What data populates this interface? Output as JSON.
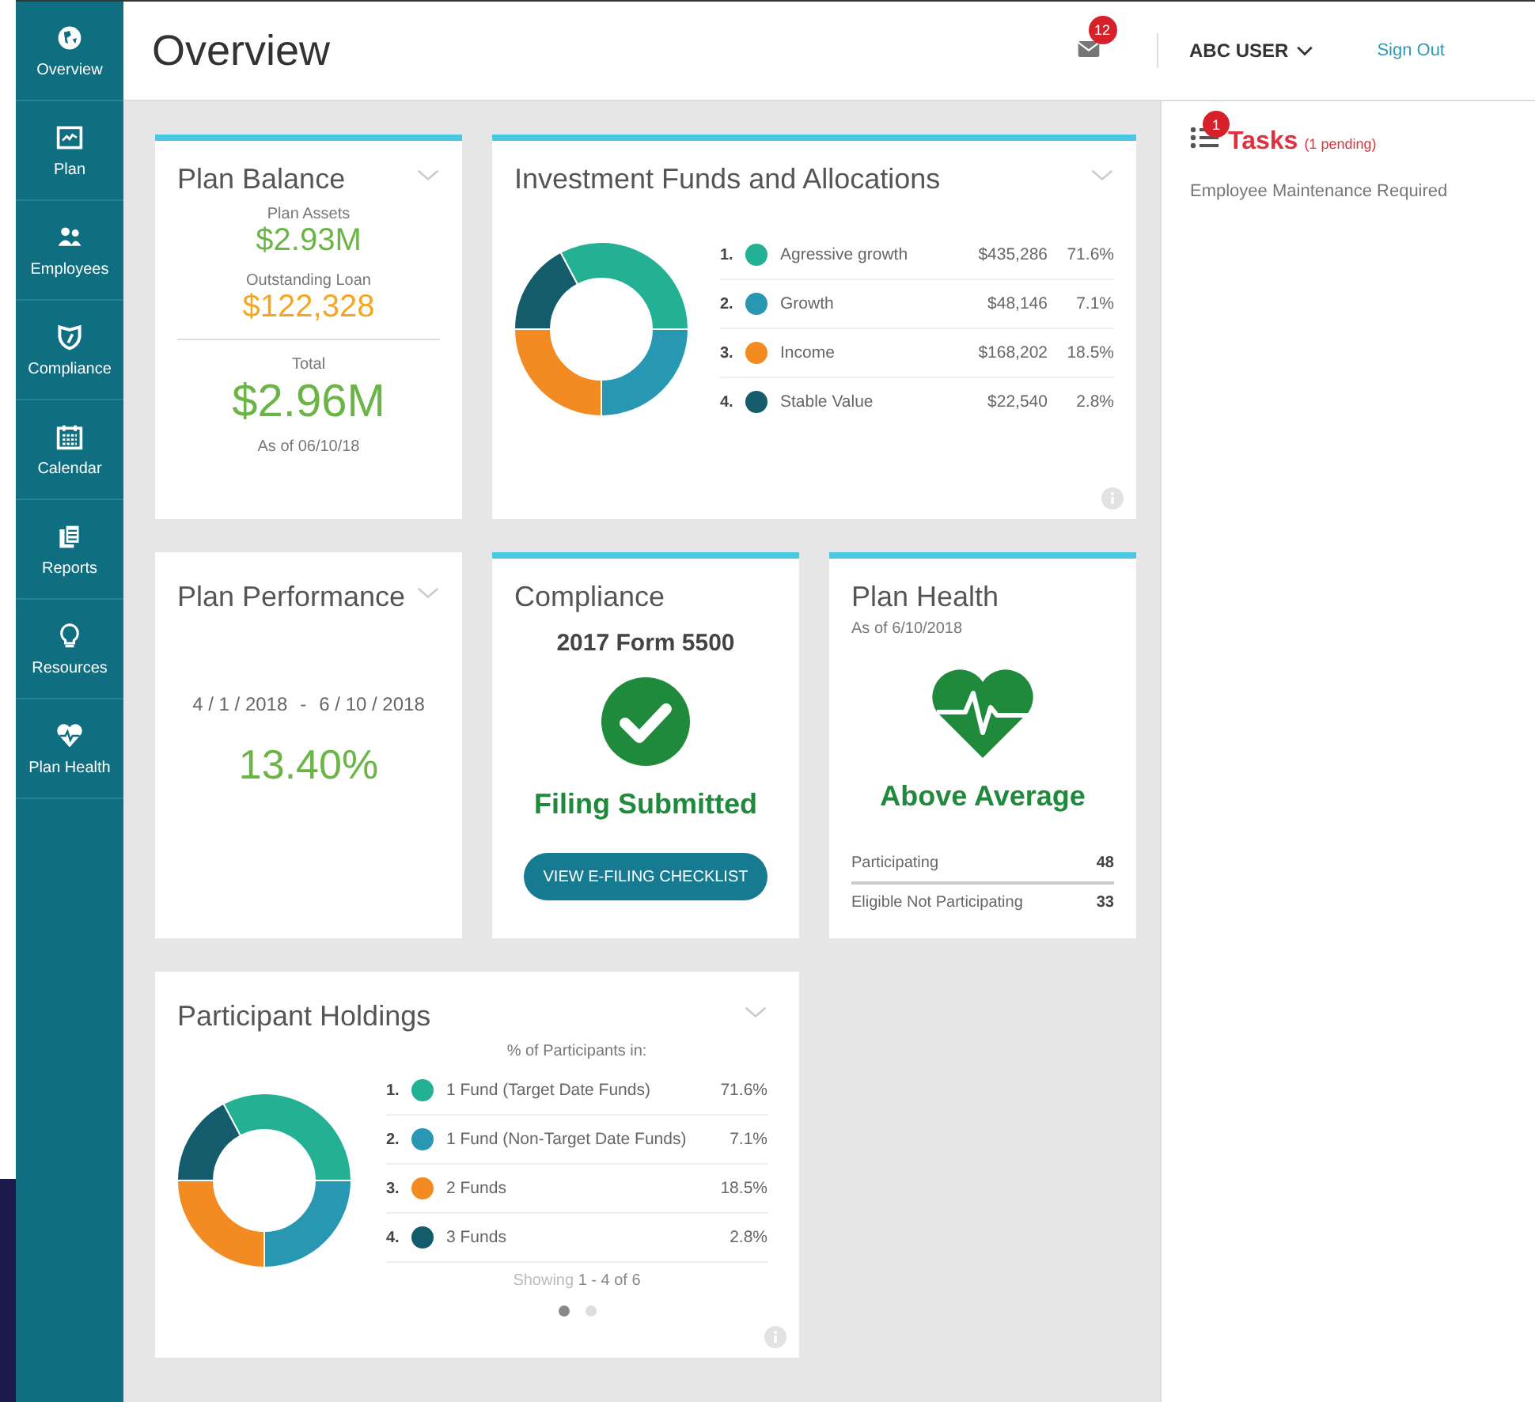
{
  "sidebar": {
    "items": [
      {
        "label": "Overview",
        "kind": "globe"
      },
      {
        "label": "Plan",
        "kind": "chart"
      },
      {
        "label": "Employees",
        "kind": "people"
      },
      {
        "label": "Compliance",
        "kind": "shield"
      },
      {
        "label": "Calendar",
        "kind": "calendar"
      },
      {
        "label": "Reports",
        "kind": "reports"
      },
      {
        "label": "Resources",
        "kind": "bulb"
      },
      {
        "label": "Plan Health",
        "kind": "heart"
      }
    ]
  },
  "header": {
    "title": "Overview",
    "mail_count": "12",
    "user": "ABC USER",
    "sign_out": "Sign Out"
  },
  "plan_balance": {
    "title": "Plan Balance",
    "accent": true,
    "assets_label": "Plan Assets",
    "assets": "$2.93M",
    "loan_label": "Outstanding Loan",
    "loan": "$122,328",
    "total_label": "Total",
    "total": "$2.96M",
    "as_of": "As of 06/10/18"
  },
  "investment_funds": {
    "title": "Investment Funds and Allocations",
    "accent": true,
    "items": [
      {
        "index": "1.",
        "name": "Agressive growth",
        "amount": "$435,286",
        "percent": "71.6%",
        "color": "#23b093"
      },
      {
        "index": "2.",
        "name": "Growth",
        "amount": "$48,146",
        "percent": "7.1%",
        "color": "#2797b2"
      },
      {
        "index": "3.",
        "name": "Income",
        "amount": "$168,202",
        "percent": "18.5%",
        "color": "#f28c22"
      },
      {
        "index": "4.",
        "name": "Stable Value",
        "amount": "$22,540",
        "percent": "2.8%",
        "color": "#145b6b"
      }
    ]
  },
  "plan_performance": {
    "title": "Plan Performance",
    "accent": false,
    "start": "4 / 1 / 2018",
    "separator": "-",
    "end": "6 / 10 / 2018",
    "return": "13.40%"
  },
  "compliance": {
    "title": "Compliance",
    "accent": true,
    "form": "2017 Form 5500",
    "status": "Filing Submitted",
    "button": "VIEW E-FILING CHECKLIST"
  },
  "plan_health": {
    "title": "Plan Health",
    "accent": true,
    "as_of": "As of 6/10/2018",
    "status": "Above Average",
    "stats": [
      {
        "label": "Participating",
        "value": "48"
      },
      {
        "label": "Eligible Not Participating",
        "value": "33"
      }
    ]
  },
  "participant_holdings": {
    "title": "Participant Holdings",
    "accent": false,
    "caption": "% of Participants in:",
    "items": [
      {
        "index": "1.",
        "name": "1 Fund (Target Date Funds)",
        "percent": "71.6%",
        "color": "#23b093"
      },
      {
        "index": "2.",
        "name": "1 Fund (Non-Target Date Funds)",
        "percent": "7.1%",
        "color": "#2797b2"
      },
      {
        "index": "3.",
        "name": "2 Funds",
        "percent": "18.5%",
        "color": "#f28c22"
      },
      {
        "index": "4.",
        "name": "3 Funds",
        "percent": "2.8%",
        "color": "#145b6b"
      }
    ],
    "showing_prefix": "Showing",
    "showing_range": "1 - 4 of 6",
    "pages": [
      {
        "selected": true
      },
      {
        "selected": false
      }
    ]
  },
  "tasks": {
    "count": "1",
    "title": "Tasks",
    "pending": "(1 pending)",
    "items": [
      "Employee Maintenance Required"
    ]
  }
}
